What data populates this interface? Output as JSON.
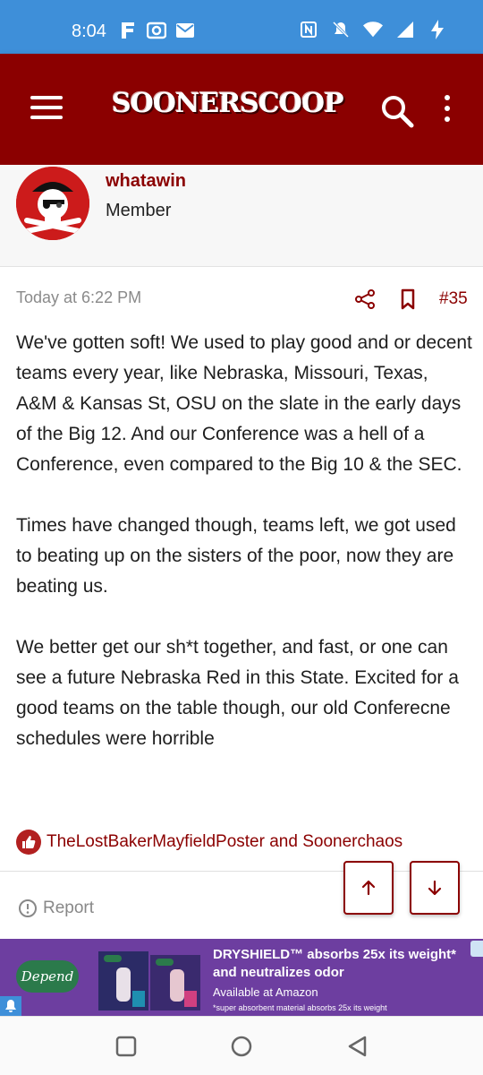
{
  "status_bar": {
    "time": "8:04",
    "left_icons": [
      "f-notification-icon",
      "camera-notification-icon",
      "mail-notification-icon"
    ],
    "right_icons": [
      "nfc-icon",
      "mute-icon",
      "wifi-icon",
      "signal-icon",
      "battery-charging-icon"
    ]
  },
  "header": {
    "brand": "SOONERSCOOP",
    "menu_icon": "hamburger-icon",
    "search_icon": "search-icon",
    "more_icon": "more-vertical-icon",
    "bg_color": "#8b0000"
  },
  "user": {
    "username": "whatawin",
    "title": "Member",
    "avatar_icon": "pirate-skull-avatar"
  },
  "post": {
    "time": "Today at 6:22 PM",
    "number": "#35",
    "paragraphs": [
      "We've gotten soft! We used to play good and or decent teams every year, like Nebraska, Missouri, Texas, A&M & Kansas St, OSU on the slate in the early days of the Big 12. And our Conference was a hell of a Conference, even compared to the Big 10 & the SEC.",
      "Times have changed though, teams left, we got used to beating up on the sisters of the poor, now they are beating us.",
      "We better get our sh*t together, and fast, or one can see a future Nebraska Red in this State. Excited for a good teams on the table though, our old Conferecne schedules were horrible"
    ],
    "reactions": "TheLostBakerMayfieldPoster and Soonerchaos",
    "report_label": "Report"
  },
  "ad": {
    "brand": "Depend",
    "headline": "DRYSHIELD™ absorbs 25x its weight* and neutralizes odor",
    "sub": "Available at Amazon",
    "fine_print": "*super absorbent material absorbs 25x its weight",
    "bg_color": "#6d3ea0"
  },
  "nav_bar": {
    "buttons": [
      "recents-icon",
      "home-icon",
      "back-icon"
    ]
  }
}
